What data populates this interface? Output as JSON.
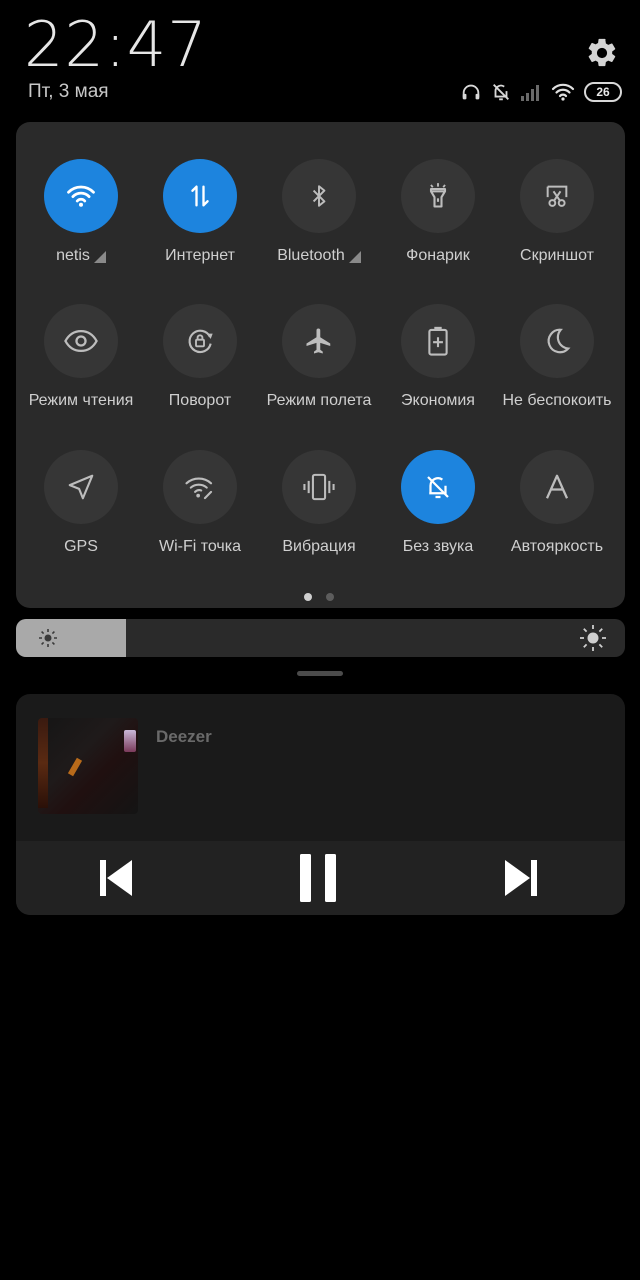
{
  "header": {
    "time": "22:47",
    "date": "Пт, 3 мая",
    "battery_level": "26",
    "settings_icon": "gear-icon",
    "status_icons": [
      "headphones-icon",
      "bell-off-icon",
      "signal-empty-icon",
      "wifi-icon",
      "battery-icon"
    ]
  },
  "quick_settings": {
    "tiles": [
      {
        "label": "netis",
        "icon": "wifi-icon",
        "active": true,
        "expand": true
      },
      {
        "label": "Интернет",
        "icon": "mobile-data-icon",
        "active": true,
        "expand": false
      },
      {
        "label": "Bluetooth",
        "icon": "bluetooth-icon",
        "active": false,
        "expand": true
      },
      {
        "label": "Фонарик",
        "icon": "flashlight-icon",
        "active": false,
        "expand": false
      },
      {
        "label": "Скриншот",
        "icon": "screenshot-icon",
        "active": false,
        "expand": false
      },
      {
        "label": "Режим чтения",
        "icon": "eye-icon",
        "active": false,
        "expand": false
      },
      {
        "label": "Поворот",
        "icon": "rotation-lock-icon",
        "active": false,
        "expand": false
      },
      {
        "label": "Режим полета",
        "icon": "airplane-icon",
        "active": false,
        "expand": false
      },
      {
        "label": "Экономия",
        "icon": "battery-saver-icon",
        "active": false,
        "expand": false
      },
      {
        "label": "Не беспокоить",
        "icon": "moon-icon",
        "active": false,
        "expand": false
      },
      {
        "label": "GPS",
        "icon": "location-arrow-icon",
        "active": false,
        "expand": false
      },
      {
        "label": "Wi-Fi точка",
        "icon": "hotspot-icon",
        "active": false,
        "expand": false
      },
      {
        "label": "Вибрация",
        "icon": "vibrate-icon",
        "active": false,
        "expand": false
      },
      {
        "label": "Без звука",
        "icon": "bell-off-icon",
        "active": true,
        "expand": false
      },
      {
        "label": "Автояркость",
        "icon": "auto-brightness-icon",
        "active": false,
        "expand": false
      }
    ],
    "pages": 2,
    "current_page": 1
  },
  "brightness": {
    "level": 0.18
  },
  "media": {
    "app_name": "Deezer",
    "controls": [
      "previous-icon",
      "pause-icon",
      "next-icon"
    ]
  },
  "colors": {
    "accent": "#1d84de",
    "panel": "#2a2a2a",
    "tile": "#363636"
  }
}
